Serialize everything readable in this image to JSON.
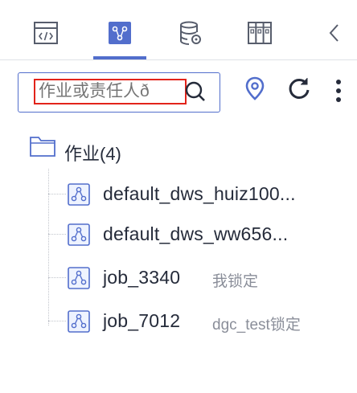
{
  "toolbar": {
    "tabs": [
      {
        "name": "code-script-tab",
        "icon": "code-file-icon"
      },
      {
        "name": "job-tab",
        "icon": "node-network-icon",
        "active": true
      },
      {
        "name": "database-tab",
        "icon": "database-settings-icon"
      },
      {
        "name": "resources-tab",
        "icon": "columns-grid-icon"
      }
    ],
    "collapse_icon": "chevron-left-icon",
    "active_color": "#526ecc"
  },
  "search": {
    "placeholder": "作业或责任人ð",
    "value": "",
    "highlight_color": "#e2231a"
  },
  "actions": {
    "locate_icon": "location-pin-icon",
    "refresh_icon": "refresh-icon",
    "more_icon": "more-vertical-icon"
  },
  "tree": {
    "folder": {
      "label": "作业(4)"
    },
    "items": [
      {
        "name": "default_dws_huiz100...",
        "lock": ""
      },
      {
        "name": "default_dws_ww656...",
        "lock": ""
      },
      {
        "name": "job_3340",
        "lock": "我锁定"
      },
      {
        "name": "job_7012",
        "lock": "dgc_test锁定"
      }
    ]
  }
}
